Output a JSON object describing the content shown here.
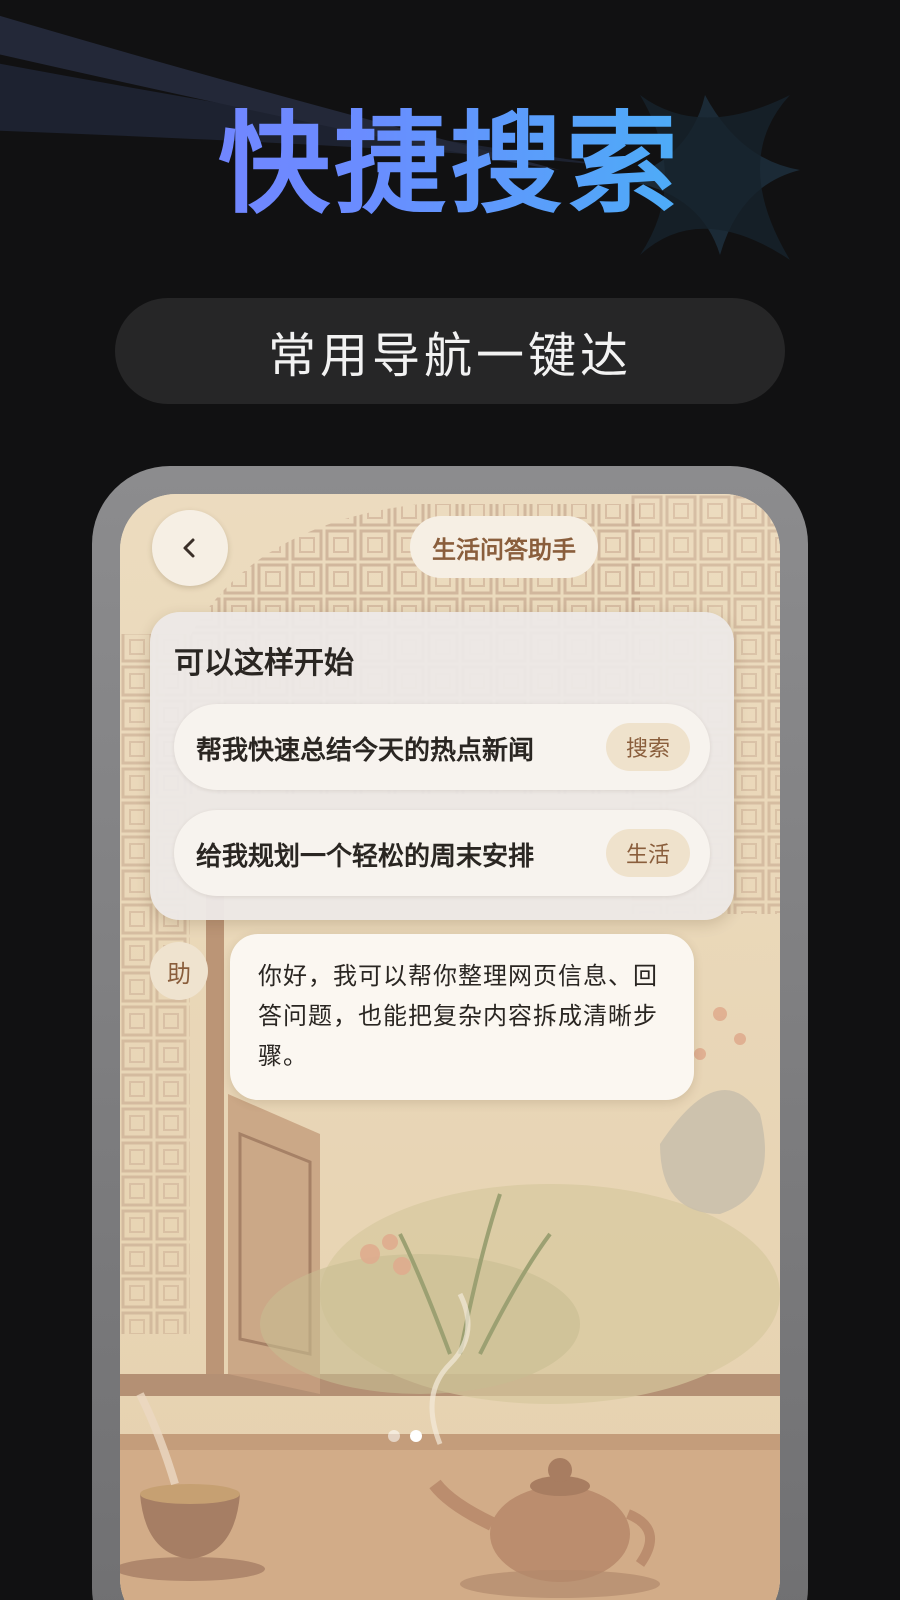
{
  "hero": {
    "title": "快捷搜索",
    "subtitle": "常用导航一键达"
  },
  "app": {
    "header_title": "生活问答助手",
    "back_icon": "chevron-left-icon"
  },
  "prompt_card": {
    "title": "可以这样开始",
    "suggestions": [
      {
        "text": "帮我快速总结今天的热点新闻",
        "tag": "搜索"
      },
      {
        "text": "给我规划一个轻松的周末安排",
        "tag": "生活"
      }
    ]
  },
  "chat": {
    "avatar_label": "助",
    "message": "你好，我可以帮你整理网页信息、回答问题，也能把复杂内容拆成清晰步骤。"
  },
  "carousel": {
    "page_count": 2,
    "active_index": 1
  },
  "colors": {
    "title_gradient_start": "#7b7dff",
    "title_gradient_end": "#39c2f2",
    "accent_brown": "#8a5e3c",
    "page_background": "#111112"
  }
}
